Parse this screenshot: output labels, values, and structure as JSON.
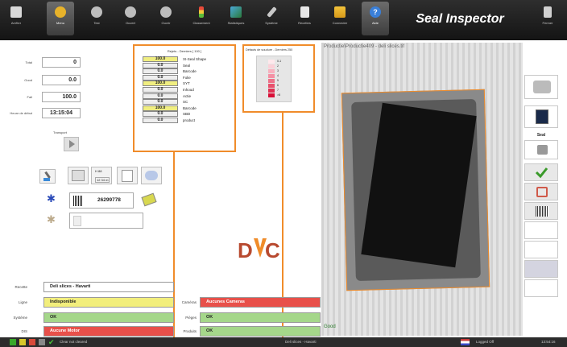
{
  "toolbar": {
    "title": "Seal Inspector",
    "buttons": [
      {
        "label": "Arrêter",
        "icon": "stop-icon"
      },
      {
        "label": "Menu",
        "icon": "menu-icon"
      },
      {
        "label": "Test",
        "icon": "test-icon"
      },
      {
        "label": "Ouvert",
        "icon": "open-icon"
      },
      {
        "label": "Ouvrir",
        "icon": "open-folder-icon"
      },
      {
        "label": "Classement",
        "icon": "ranking-icon"
      },
      {
        "label": "Statistiques",
        "icon": "statistics-icon"
      },
      {
        "label": "Système",
        "icon": "system-icon"
      },
      {
        "label": "Recettes",
        "icon": "recipes-icon"
      },
      {
        "label": "Connecter",
        "icon": "connect-icon"
      },
      {
        "label": "Aide",
        "icon": "help-icon"
      },
      {
        "label": "Fermer",
        "icon": "exit-icon"
      }
    ]
  },
  "counters": {
    "total_label": "Total",
    "total_value": "0",
    "good_label": "Good",
    "good_value": "0.0",
    "fail_label": "Fail",
    "fail_value": "100.0",
    "start_label": "Heure de début",
    "start_value": "13:15:04",
    "transport_label": "Transport"
  },
  "tools": {
    "mini_label_1": "H 88",
    "mini_label_2": "12 34 m"
  },
  "barcode": {
    "value": "26299778"
  },
  "rejects": {
    "title": "Rejets - Derniers [ 100 ]",
    "rows": [
      {
        "value": "100.0",
        "label": "XI-Seal Shape",
        "highlight": true
      },
      {
        "value": "0.0",
        "label": "Seal",
        "highlight": false
      },
      {
        "value": "0.0",
        "label": "Barcode",
        "highlight": false
      },
      {
        "value": "0.0",
        "label": "Folie",
        "highlight": false
      },
      {
        "value": "100.0",
        "label": "SYT",
        "highlight": true
      },
      {
        "value": "0.0",
        "label": "Inhoud",
        "highlight": false
      },
      {
        "value": "0.0",
        "label": "Actie",
        "highlight": false
      },
      {
        "value": "0.0",
        "label": "SC",
        "highlight": false
      },
      {
        "value": "100.0",
        "label": "Barcode",
        "highlight": true
      },
      {
        "value": "0.0",
        "label": "SBD",
        "highlight": false
      },
      {
        "value": "0.0",
        "label": "product",
        "highlight": false
      }
    ]
  },
  "welding": {
    "title": "Défauts de soudure - Derniers 250",
    "legend_labels": [
      "0-1",
      "2",
      "3",
      "4",
      "5",
      "6",
      "7",
      ">8"
    ]
  },
  "image": {
    "path": "Productie\\Productie409 - deli slices.tif",
    "result": "Good"
  },
  "status": {
    "recipe_label": "Recette",
    "recipe_value": "Deli slices - Havarti",
    "line_label": "Ligne",
    "line_value": "Indisponible",
    "system_label": "Système",
    "system_value": "OK",
    "dis_label": "DIS",
    "dis_value": "Aucune Motor",
    "cameras_label": "Caméras",
    "cameras_value": "Aucunes Cameras",
    "triggers_label": "Pièges",
    "triggers_value": "OK",
    "product_label": "Produits",
    "product_value": "OK"
  },
  "sidebar": {
    "seal_label": "Seal"
  },
  "bottombar": {
    "message": "Clear not cleared",
    "recipe": "Deli slices - Havarti",
    "user": "Logged Off",
    "time": "13:54:16"
  },
  "colors": {
    "accent_orange": "#f08c2a",
    "ok_green": "#a5d78a",
    "error_red": "#e8504a",
    "warn_yellow": "#f2ee7c"
  }
}
